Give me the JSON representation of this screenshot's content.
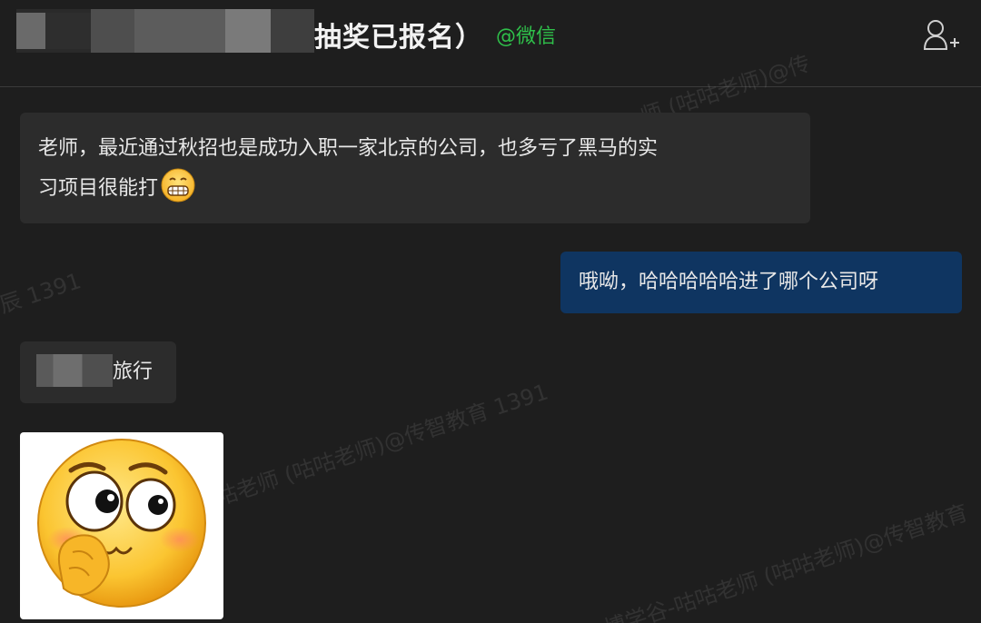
{
  "header": {
    "title_visible": "抽奖已报名）",
    "title_tag": "@微信",
    "add_contact_icon": "add-contact-icon"
  },
  "messages": [
    {
      "direction": "incoming",
      "text_line1": "老师，最近通过秋招也是成功入职一家北京的公司，也多亏了黑马的实",
      "text_line2": "习项目很能打",
      "emoji": "grimace-emoji"
    },
    {
      "direction": "outgoing",
      "text": "哦呦，哈哈哈哈哈进了哪个公司呀"
    },
    {
      "direction": "incoming",
      "text_suffix": "旅行"
    },
    {
      "direction": "incoming",
      "sticker": "thinking-face-sticker"
    }
  ],
  "watermarks": {
    "w1": "师 (咕咕老师)@传",
    "w2": "辰 1391",
    "w3": "咕老师 (咕咕老师)@传智教育 1391",
    "w4": "博学谷-咕咕老师 (咕咕老师)@传智教育"
  },
  "colors": {
    "background": "#1e1e1e",
    "incoming_bubble": "#2c2c2c",
    "outgoing_bubble": "#0f3561",
    "tag_green": "#2fc04a"
  }
}
